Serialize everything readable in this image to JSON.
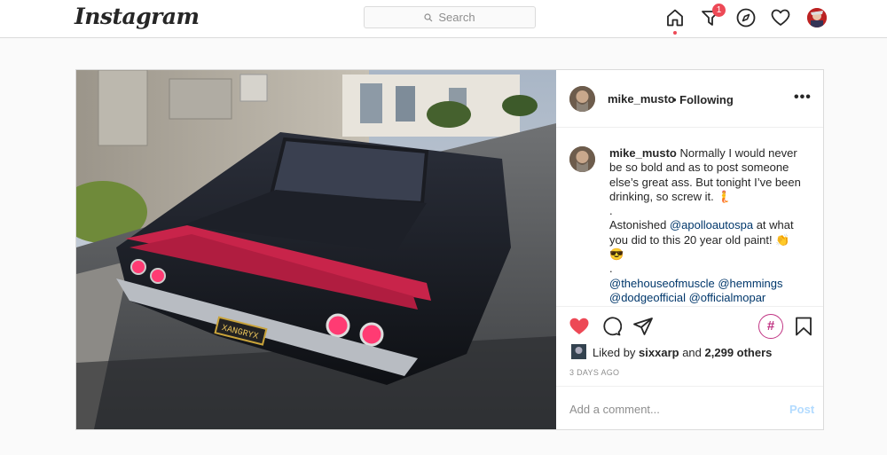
{
  "nav": {
    "logo": "Instagram",
    "search_placeholder": "Search",
    "notifications_count": "1",
    "icons": [
      "home-icon",
      "direct-icon",
      "explore-icon",
      "activity-heart-icon",
      "profile-avatar"
    ]
  },
  "post": {
    "username": "mike_musto",
    "follow_status": "• Following",
    "more_label": "•••",
    "caption": {
      "username": "mike_musto",
      "line1": " Normally I would never be so bold and as to post someone else’s great ass. But tonight I’ve been drinking, so screw it. 🧜",
      "sep1": ".",
      "line2_pre": "Astonished ",
      "mention1": "@apolloautospa",
      "line2_post": " at what you did to this 20 year old paint! 👏 😎",
      "sep2": ".",
      "tags": [
        "@thehouseofmuscle",
        "@hemmings",
        "@dodgeofficial",
        "@officialmopar"
      ]
    },
    "hashtag_button": "#",
    "likes": {
      "prefix": "Liked by ",
      "user": "sixxarp",
      "middle": " and ",
      "others": "2,299 others"
    },
    "timestamp": "3 DAYS AGO",
    "comment_placeholder": "Add a comment...",
    "post_label": "Post"
  },
  "colors": {
    "like_red": "#ed4956",
    "link_blue": "#00376b",
    "post_disabled": "#b3dbff",
    "hashtag_purple": "#c13584"
  }
}
